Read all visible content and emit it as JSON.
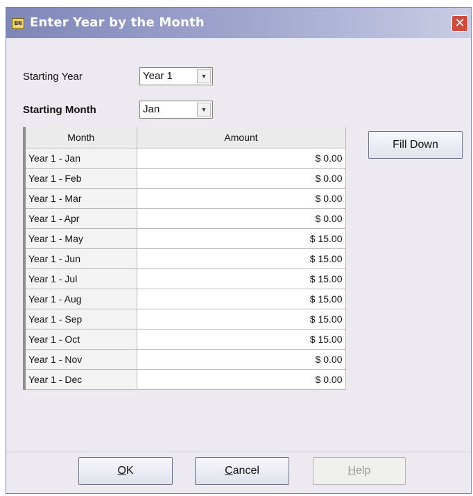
{
  "window": {
    "title": "Enter Year by the Month",
    "app_icon_text": "BN",
    "close_glyph": "✕"
  },
  "starting_year": {
    "label": "Starting Year",
    "value": "Year 1"
  },
  "starting_month": {
    "label": "Starting Month",
    "value": "Jan"
  },
  "table": {
    "columns": [
      "Month",
      "Amount"
    ],
    "rows": [
      {
        "month": "Year 1 - Jan",
        "amount": "$ 0.00"
      },
      {
        "month": "Year 1 - Feb",
        "amount": "$ 0.00"
      },
      {
        "month": "Year 1 - Mar",
        "amount": "$ 0.00"
      },
      {
        "month": "Year 1 - Apr",
        "amount": "$ 0.00"
      },
      {
        "month": "Year 1 - May",
        "amount": "$ 15.00"
      },
      {
        "month": "Year 1 - Jun",
        "amount": "$ 15.00"
      },
      {
        "month": "Year 1 - Jul",
        "amount": "$ 15.00"
      },
      {
        "month": "Year 1 - Aug",
        "amount": "$ 15.00"
      },
      {
        "month": "Year 1 - Sep",
        "amount": "$ 15.00"
      },
      {
        "month": "Year 1 - Oct",
        "amount": "$ 15.00"
      },
      {
        "month": "Year 1 - Nov",
        "amount": "$ 0.00"
      },
      {
        "month": "Year 1 - Dec",
        "amount": "$ 0.00"
      }
    ]
  },
  "buttons": {
    "fill_down": "Fill Down",
    "ok_mnemonic": "O",
    "ok_rest": "K",
    "cancel_mnemonic": "C",
    "cancel_rest": "ancel",
    "help_mnemonic": "H",
    "help_rest": "elp"
  },
  "colors": {
    "titlebar_start": "#7f87b8",
    "dialog_bg": "#ece9f1",
    "close_red": "#d04a3c"
  },
  "icons": {
    "app": "app-logo-icon",
    "close": "close-icon",
    "dropdown": "chevron-down-icon"
  }
}
